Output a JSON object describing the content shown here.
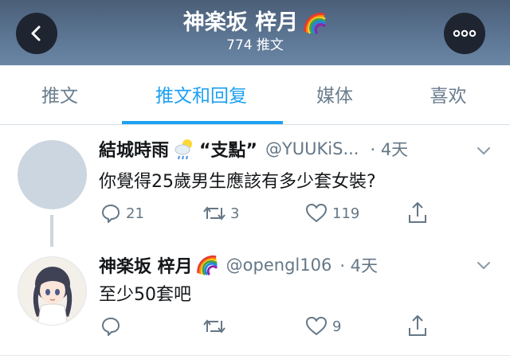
{
  "header": {
    "display_name": "神楽坂 梓月",
    "tweet_count": "774 推文",
    "back_icon": "back-arrow-icon",
    "more_icon": "more-dots-icon"
  },
  "tabs": [
    {
      "label": "推文",
      "active": false
    },
    {
      "label": "推文和回复",
      "active": true
    },
    {
      "label": "媒体",
      "active": false
    },
    {
      "label": "喜欢",
      "active": false
    }
  ],
  "tweets": [
    {
      "name": "結城時雨",
      "name_suffix": "“支點”",
      "handle": "@YUUKiS...",
      "time": "· 4天",
      "text": "你覺得25歲男生應該有多少套女裝?",
      "replies": "21",
      "retweets": "3",
      "likes": "119"
    },
    {
      "name": "神楽坂 梓月",
      "handle": "@opengl106",
      "time": "· 4天",
      "text": "至少50套吧",
      "replies": "",
      "retweets": "",
      "likes": "9"
    }
  ],
  "colors": {
    "accent": "#1da1f2",
    "header_bg": "#5b7593",
    "text_primary": "#14171a",
    "text_secondary": "#657786"
  }
}
